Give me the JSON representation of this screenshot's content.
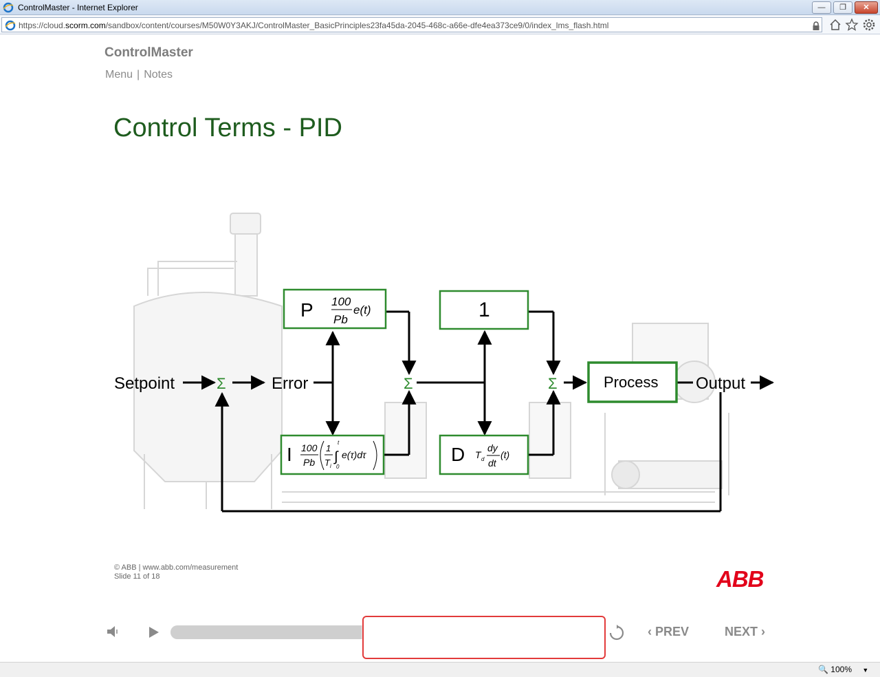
{
  "window": {
    "title": "ControlMaster - Internet Explorer",
    "url_prefix": "https://cloud.",
    "url_domain": "scorm.com",
    "url_path": "/sandbox/content/courses/M50W0Y3AKJ/ControlMaster_BasicPrinciples23fa45da-2045-468c-a66e-dfe4ea373ce9/0/index_lms_flash.html"
  },
  "course": {
    "title": "ControlMaster",
    "nav_menu": "Menu",
    "nav_separator": "|",
    "nav_notes": "Notes"
  },
  "slide": {
    "title": "Control Terms - PID"
  },
  "diagram": {
    "setpoint": "Setpoint",
    "error": "Error",
    "sigma": "Σ",
    "p_letter": "P",
    "p_num": "100",
    "p_den": "Pb",
    "p_fn": "e(t)",
    "one": "1",
    "i_letter": "I",
    "i_num": "100",
    "i_den": "Pb",
    "i_inner_num": "1",
    "i_inner_den": "T",
    "i_inner_sub": "i",
    "i_upper": "t",
    "i_lower": "0",
    "i_integrand": "e(τ)dτ",
    "d_letter": "D",
    "d_coef": "T",
    "d_coef_sub": "d",
    "d_num": "dy",
    "d_den": "dt",
    "d_fn": "(t)",
    "process": "Process",
    "output": "Output",
    "accent_color": "#2e8b2e"
  },
  "footer": {
    "copyright": "© ABB | www.abb.com/measurement",
    "slide_counter": "Slide 11 of 18",
    "logo": "ABB"
  },
  "player": {
    "progress": 0.44,
    "prev_label": "PREV",
    "next_label": "NEXT"
  },
  "status": {
    "zoom": "100%"
  }
}
